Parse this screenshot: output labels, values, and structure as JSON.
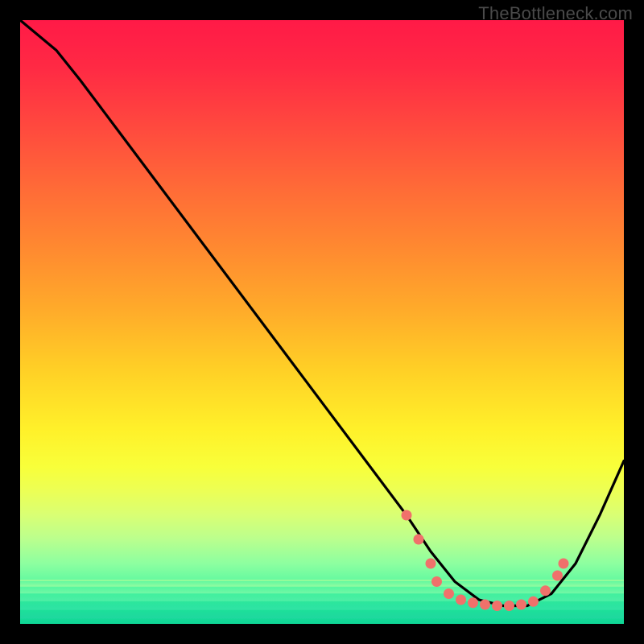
{
  "watermark": "TheBottleneck.com",
  "colors": {
    "background": "#000000",
    "curve": "#000000",
    "markers": "#f0716b",
    "watermark": "#4a4a4a"
  },
  "chart_data": {
    "type": "line",
    "title": "",
    "xlabel": "",
    "ylabel": "",
    "xlim": [
      0,
      100
    ],
    "ylim": [
      0,
      100
    ],
    "grid": false,
    "axes_visible": false,
    "series": [
      {
        "name": "bottleneck-curve",
        "x": [
          0,
          6,
          10,
          16,
          22,
          28,
          34,
          40,
          46,
          52,
          58,
          64,
          68,
          72,
          76,
          80,
          84,
          88,
          92,
          96,
          100
        ],
        "y": [
          100,
          95,
          90,
          82,
          74,
          66,
          58,
          50,
          42,
          34,
          26,
          18,
          12,
          7,
          4,
          3,
          3,
          5,
          10,
          18,
          27
        ]
      }
    ],
    "markers": [
      {
        "x": 64,
        "y": 18
      },
      {
        "x": 66,
        "y": 14
      },
      {
        "x": 68,
        "y": 10
      },
      {
        "x": 69,
        "y": 7
      },
      {
        "x": 71,
        "y": 5
      },
      {
        "x": 73,
        "y": 4
      },
      {
        "x": 75,
        "y": 3.5
      },
      {
        "x": 77,
        "y": 3.2
      },
      {
        "x": 79,
        "y": 3
      },
      {
        "x": 81,
        "y": 3
      },
      {
        "x": 83,
        "y": 3.2
      },
      {
        "x": 85,
        "y": 3.7
      },
      {
        "x": 87,
        "y": 5.5
      },
      {
        "x": 89,
        "y": 8
      },
      {
        "x": 90,
        "y": 10
      }
    ],
    "notes": "Gradient heat background (red→yellow→green) with a black V-shaped curve; pink dotted markers cluster in the trough near x≈64–90."
  }
}
